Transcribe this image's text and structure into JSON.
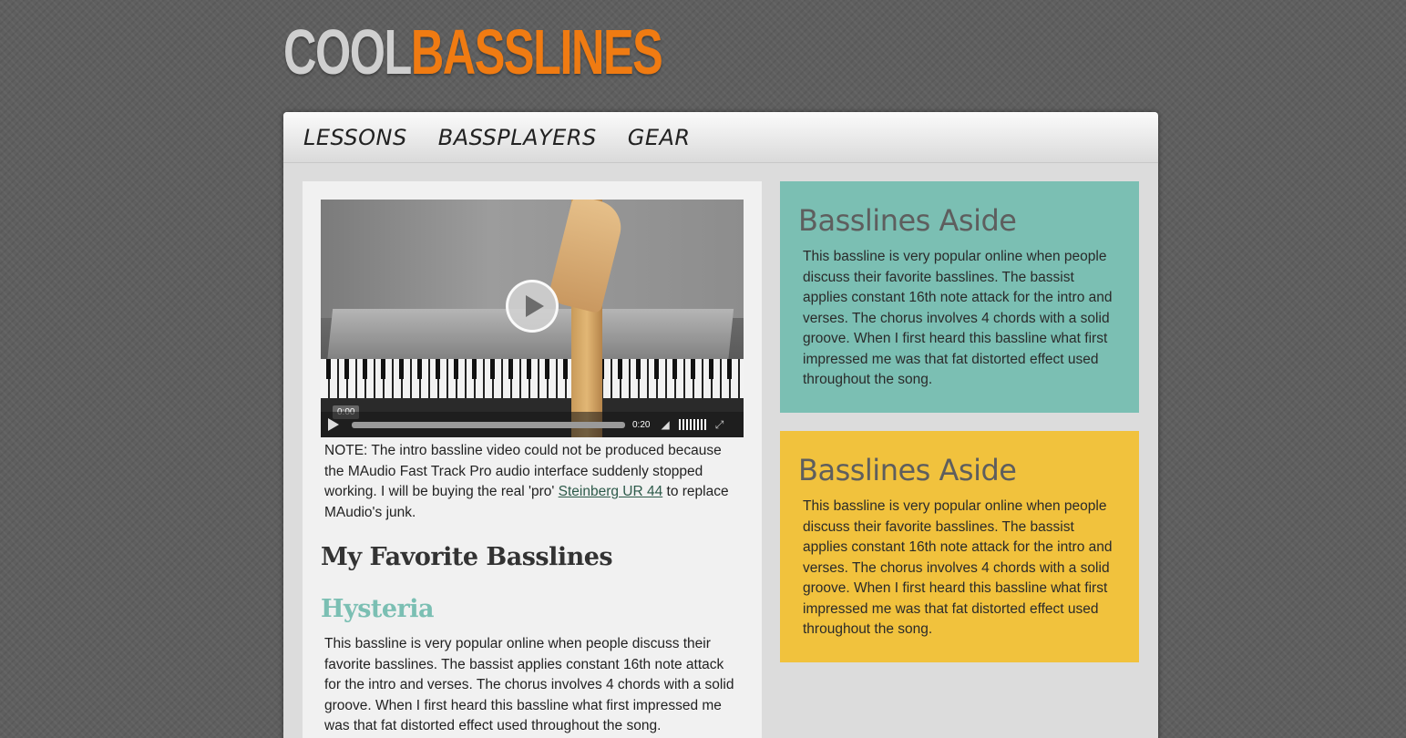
{
  "logo": {
    "part1": "COOL",
    "part2": "BASSLINES"
  },
  "nav": {
    "items": [
      {
        "label": "LESSONS"
      },
      {
        "label": "BASSPLAYERS"
      },
      {
        "label": "GEAR"
      }
    ]
  },
  "video": {
    "current_time": "0:00",
    "duration": "0:20"
  },
  "note": {
    "before_link": "NOTE: The intro bassline video could not be produced because the MAudio Fast Track Pro audio interface suddenly stopped working. I will be buying the real 'pro' ",
    "link": "Steinberg UR 44",
    "after_link": " to replace MAudio's junk."
  },
  "main": {
    "title": "My Favorite Basslines",
    "song_title": "Hysteria",
    "song_text": "This bassline is very popular online when people discuss their favorite basslines. The bassist applies constant 16th note attack for the intro and verses. The chorus involves 4 chords with a solid groove. When I first heard this bassline what first impressed me was that fat distorted effect used throughout the song."
  },
  "asides": [
    {
      "title": "Basslines Aside",
      "text": "This bassline is very popular online when people discuss their favorite basslines. The bassist applies constant 16th note attack for the intro and verses. The chorus involves 4 chords with a solid groove. When I first heard this bassline what first impressed me was that fat distorted effect used throughout the song.",
      "color": "#7bbfb3"
    },
    {
      "title": "Basslines Aside",
      "text": "This bassline is very popular online when people discuss their favorite basslines. The bassist applies constant 16th note attack for the intro and verses. The chorus involves 4 chords with a solid groove. When I first heard this bassline what first impressed me was that fat distorted effect used throughout the song.",
      "color": "#f1c23d"
    }
  ],
  "colors": {
    "accent_orange": "#f07b12",
    "logo_gray": "#cfcfcf",
    "song_teal": "#7bbfb3"
  }
}
